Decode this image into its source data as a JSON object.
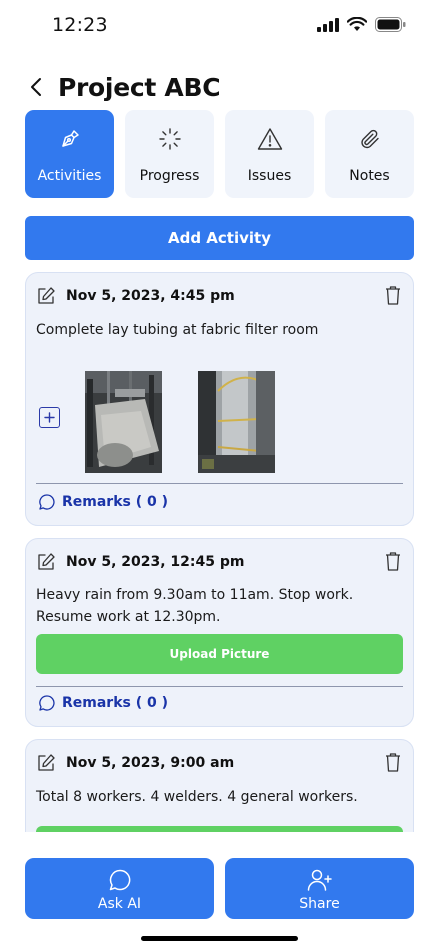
{
  "status_bar": {
    "time": "12:23"
  },
  "header": {
    "title": "Project ABC"
  },
  "tabs": [
    {
      "label": "Activities",
      "icon": "pen-nib-icon",
      "active": true
    },
    {
      "label": "Progress",
      "icon": "loader-icon",
      "active": false
    },
    {
      "label": "Issues",
      "icon": "warning-triangle-icon",
      "active": false
    },
    {
      "label": "Notes",
      "icon": "paperclip-icon",
      "active": false
    }
  ],
  "add_activity_label": "Add Activity",
  "activities": [
    {
      "date": "Nov 5, 2023, 4:45 pm",
      "text": "Complete lay tubing at fabric filter room",
      "remarks": "Remarks ( 0 )"
    },
    {
      "date": "Nov 5, 2023, 12:45 pm",
      "text": "Heavy rain from 9.30am to 11am. Stop work. Resume work at 12.30pm.",
      "upload_label": "Upload Picture",
      "remarks": "Remarks ( 0 )"
    },
    {
      "date": "Nov 5, 2023, 9:00 am",
      "text": "Total 8 workers. 4 welders. 4 general workers."
    }
  ],
  "bottom_buttons": {
    "ask_ai": "Ask AI",
    "share": "Share"
  },
  "colors": {
    "primary": "#3279ee",
    "upload_green": "#5fd163",
    "card_bg": "#eef2fa",
    "remarks_text": "#1a34a8"
  }
}
